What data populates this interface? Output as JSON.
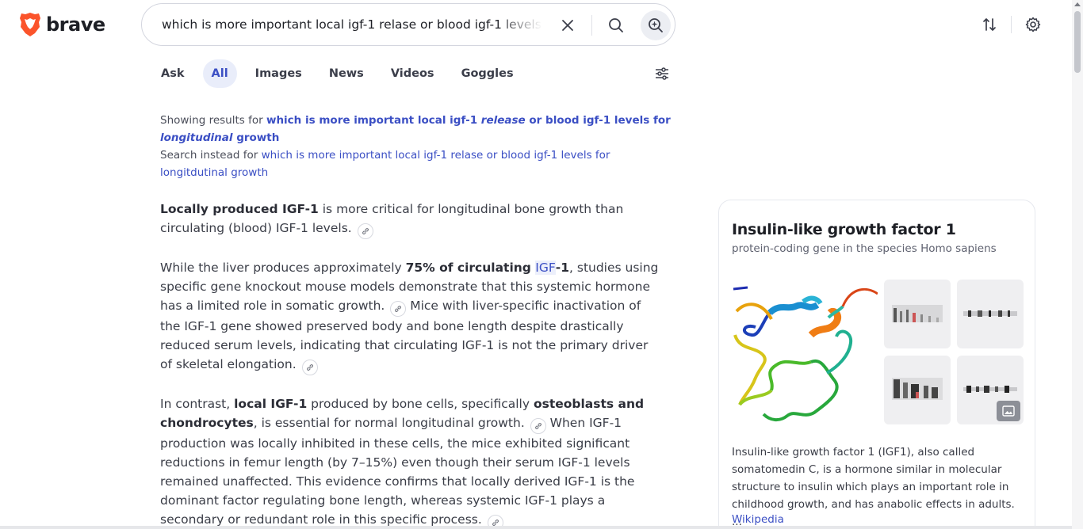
{
  "header": {
    "logo_text": "brave",
    "brand_color": "#fb542b",
    "search_query": "which is more important local igf-1 relase or blood igf-1 levels for longitdutinal growth"
  },
  "tabs": [
    {
      "label": "Ask",
      "active": false
    },
    {
      "label": "All",
      "active": true
    },
    {
      "label": "Images",
      "active": false
    },
    {
      "label": "News",
      "active": false
    },
    {
      "label": "Videos",
      "active": false
    },
    {
      "label": "Goggles",
      "active": false
    }
  ],
  "notice": {
    "showing_prefix": "Showing results for ",
    "corrected_part1": "which is more important local igf-1 ",
    "corrected_em1": "release",
    "corrected_part2": " or blood igf-1 levels for ",
    "corrected_em2": "longitudinal",
    "corrected_part3": " growth",
    "instead_prefix": "Search instead for ",
    "original_query": "which is more important local igf-1 relase or blood igf-1 levels for longitdutinal growth"
  },
  "answer": {
    "p1_bold": "Locally produced IGF-1",
    "p1_text": " is more critical for longitudinal bone growth than circulating (blood) IGF-1 levels.",
    "p2_a": "While the liver produces approximately ",
    "p2_bold1": "75% of circulating ",
    "p2_hl": "IGF",
    "p2_bold2": "-1",
    "p2_b": ", studies using specific gene knockout mouse models demonstrate that this systemic hormone has a limited role in somatic growth.",
    "p2_c": " Mice with liver-specific inactivation of the IGF-1 gene showed preserved body and bone length despite drastically reduced serum levels, indicating that circulating IGF-1 is not the primary driver of skeletal elongation.",
    "p3_a": "In contrast, ",
    "p3_bold1": "local IGF-1",
    "p3_b": " produced by bone cells, specifically ",
    "p3_bold2": "osteoblasts and chondrocytes",
    "p3_c": ", is essential for normal longitudinal growth.",
    "p3_d": " When IGF-1 production was locally inhibited in these cells, the mice exhibited significant reductions in femur length (by 7–15%) even though their serum IGF-1 levels remained unaffected. This evidence confirms that locally derived IGF-1 is the dominant factor regulating bone length, whereas systemic IGF-1 plays a secondary or redundant role in this specific process."
  },
  "knowledge_panel": {
    "title": "Insulin-like growth factor 1",
    "subtitle": "protein-coding gene in the species Homo sapiens",
    "description": "Insulin-like growth factor 1 (IGF1), also called somatomedin C, is a hormone similar in molecular structure to insulin which plays an important role in childhood growth, and has anabolic effects in adults. ...",
    "source_link": "Wikipedia"
  }
}
